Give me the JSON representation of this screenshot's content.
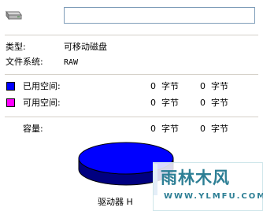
{
  "header": {
    "drive_icon": "removable-drive-icon",
    "name_value": ""
  },
  "info": {
    "type_label": "类型:",
    "type_value": "可移动磁盘",
    "fs_label": "文件系统:",
    "fs_value": "RAW"
  },
  "space": {
    "used": {
      "label": "已用空间:",
      "color": "#0000ff",
      "bytes": "0",
      "bytes_unit": "字节",
      "size": "0",
      "size_unit": "字节"
    },
    "free": {
      "label": "可用空间:",
      "color": "#ff00ff",
      "bytes": "0",
      "bytes_unit": "字节",
      "size": "0",
      "size_unit": "字节"
    },
    "capacity": {
      "label": "容量:",
      "bytes": "0",
      "bytes_unit": "字节",
      "size": "0",
      "size_unit": "字节"
    }
  },
  "pie": {
    "used_color": "#0000ff",
    "used_fraction": 1.0
  },
  "drive_label": "驱动器 H",
  "watermark": {
    "brand": "雨林木风",
    "url": "WWW.YLMFU.COM"
  }
}
